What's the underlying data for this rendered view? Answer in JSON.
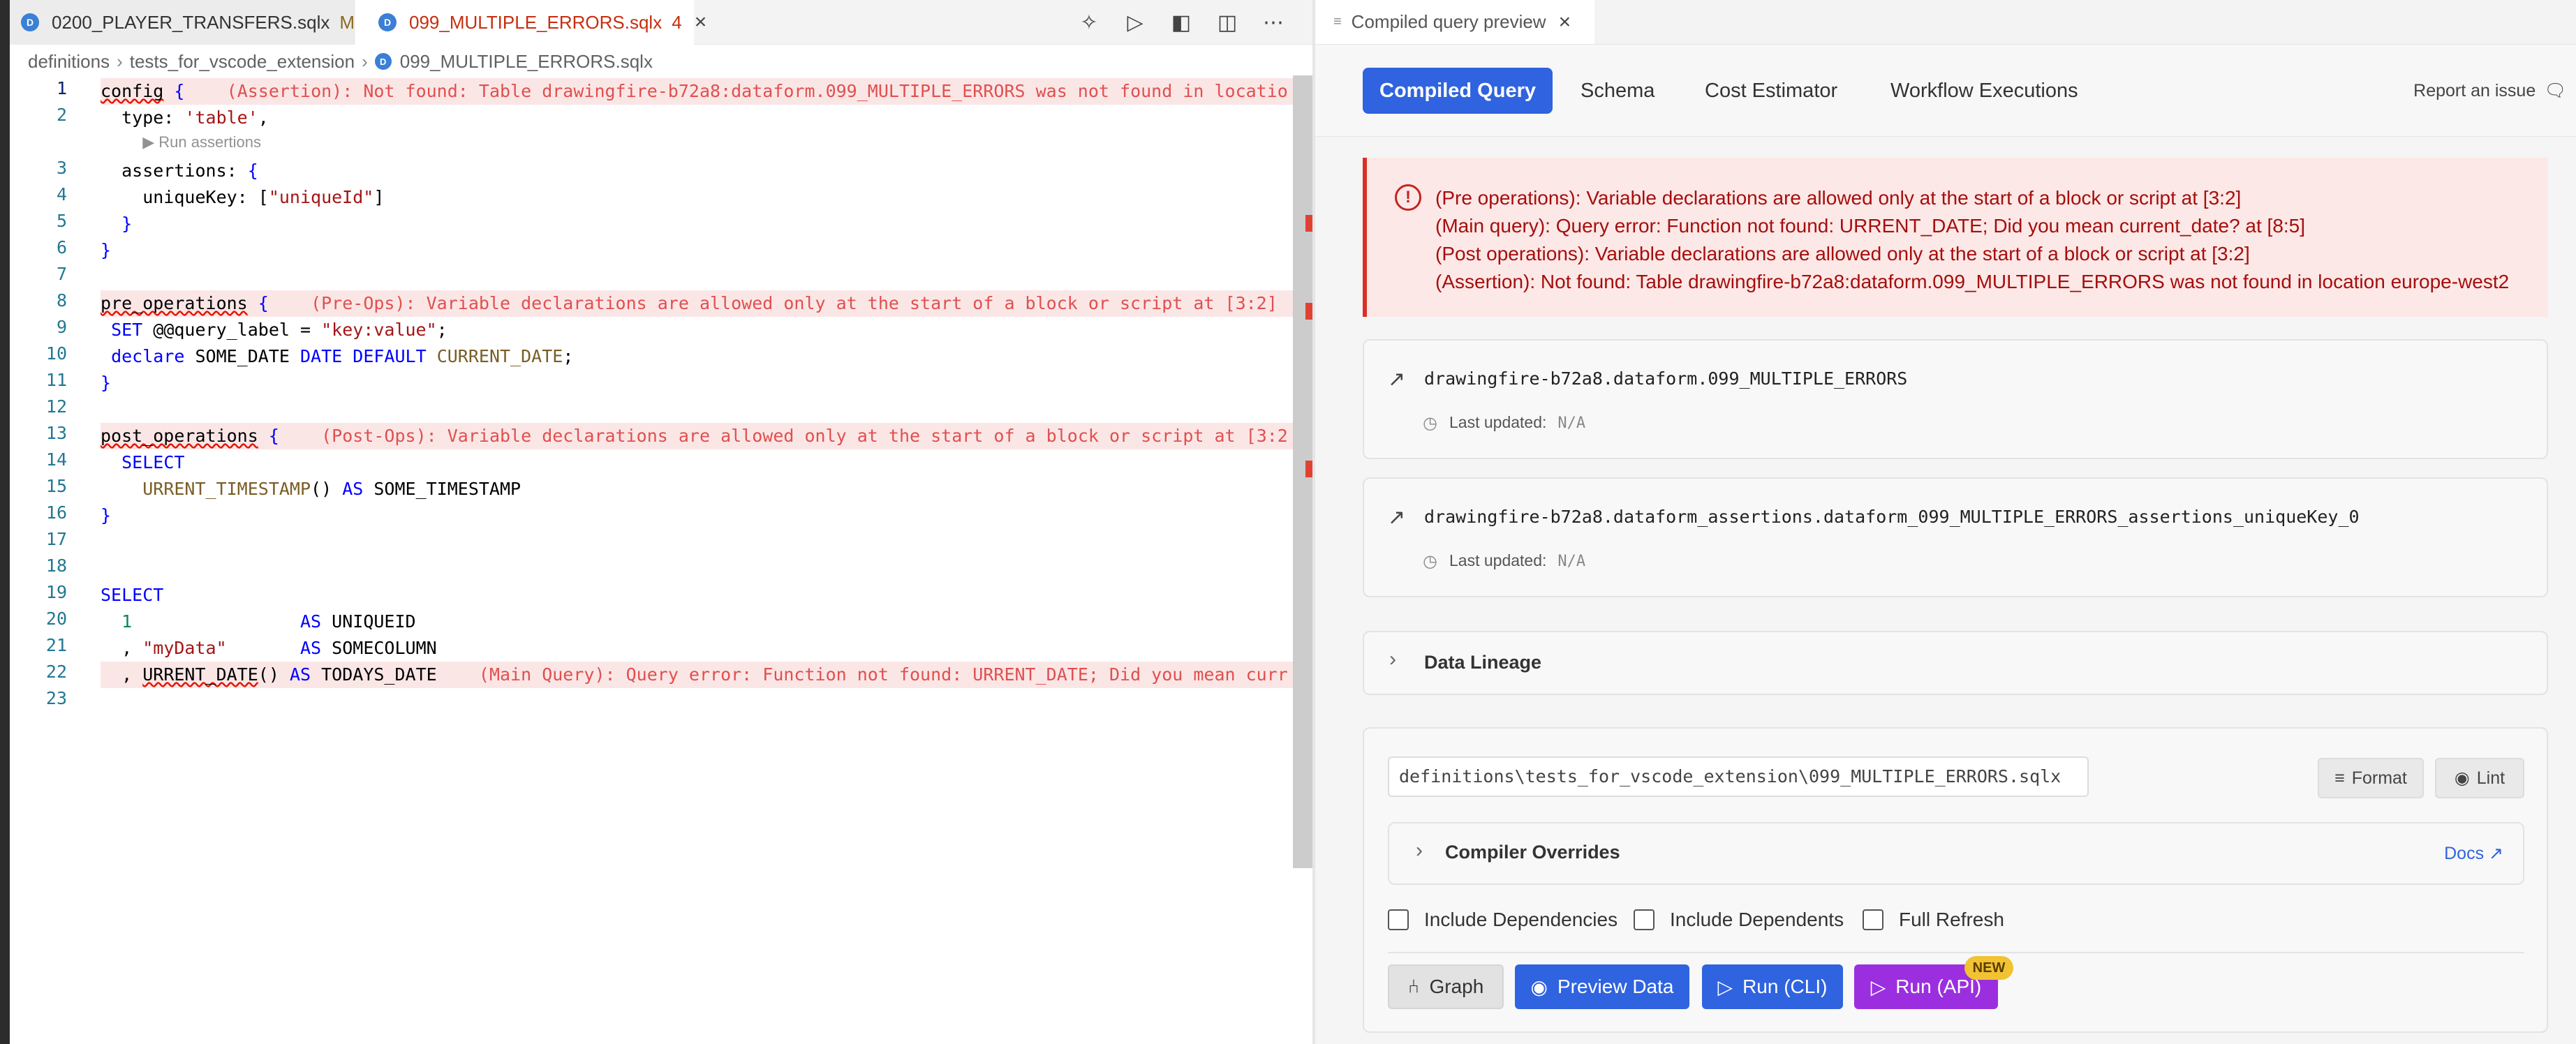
{
  "editor": {
    "tabs": [
      {
        "label": "0200_PLAYER_TRANSFERS.sqlx",
        "badge": "M",
        "icon": "D"
      },
      {
        "label": "099_MULTIPLE_ERRORS.sqlx",
        "badge": "4",
        "icon": "D"
      }
    ],
    "breadcrumb": [
      "definitions",
      "tests_for_vscode_extension",
      "099_MULTIPLE_ERRORS.sqlx"
    ],
    "code_lens": "▶ Run assertions",
    "inline_errors": {
      "line1": "(Assertion): Not found: Table drawingfire-b72a8:dataform.099_MULTIPLE_ERRORS was not found in locatio",
      "line8": "(Pre-Ops): Variable declarations are allowed only at the start of a block or script at [3:2]",
      "line13": "(Post-Ops): Variable declarations are allowed only at the start of a block or script at [3:2",
      "line22": "(Main Query): Query error: Function not found: URRENT_DATE; Did you mean curr"
    },
    "line_numbers": [
      "1",
      "2",
      "3",
      "4",
      "5",
      "6",
      "7",
      "8",
      "9",
      "10",
      "11",
      "12",
      "13",
      "14",
      "15",
      "16",
      "17",
      "18",
      "19",
      "20",
      "21",
      "22",
      "23"
    ]
  },
  "preview": {
    "tab_title": "Compiled query preview",
    "nav": [
      "Compiled Query",
      "Schema",
      "Cost Estimator",
      "Workflow Executions"
    ],
    "report_issue": "Report an issue",
    "errors": [
      "(Pre operations): Variable declarations are allowed only at the start of a block or script at [3:2]",
      "(Main query): Query error: Function not found: URRENT_DATE; Did you mean current_date? at [8:5]",
      "(Post operations): Variable declarations are allowed only at the start of a block or script at [3:2]",
      "(Assertion): Not found: Table drawingfire-b72a8:dataform.099_MULTIPLE_ERRORS was not found in location europe-west2"
    ],
    "targets": [
      {
        "name": "drawingfire-b72a8.dataform.099_MULTIPLE_ERRORS",
        "last_updated_label": "Last updated:",
        "last_updated_value": "N/A"
      },
      {
        "name": "drawingfire-b72a8.dataform_assertions.dataform_099_MULTIPLE_ERRORS_assertions_uniqueKey_0",
        "last_updated_label": "Last updated:",
        "last_updated_value": "N/A"
      }
    ],
    "data_lineage": "Data Lineage",
    "file_path": "definitions\\tests_for_vscode_extension\\099_MULTIPLE_ERRORS.sqlx",
    "format_label": "Format",
    "lint_label": "Lint",
    "compiler_overrides": "Compiler Overrides",
    "docs_label": "Docs",
    "checkboxes": [
      "Include Dependencies",
      "Include Dependents",
      "Full Refresh"
    ],
    "actions": {
      "graph": "Graph",
      "preview": "Preview Data",
      "run_cli": "Run (CLI)",
      "run_api": "Run (API)",
      "new_badge": "NEW"
    }
  },
  "colors": {
    "accent": "#2f63df",
    "purple": "#9b2fe0",
    "error": "#d93025",
    "badge": "#f1c232"
  }
}
